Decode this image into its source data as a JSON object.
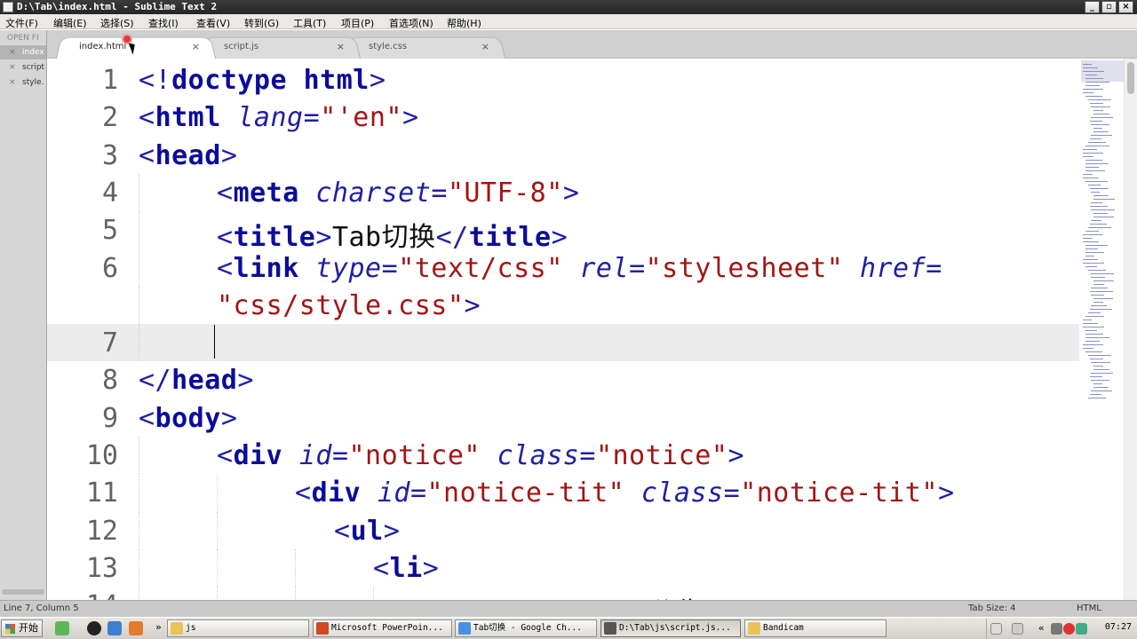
{
  "window": {
    "title": "D:\\Tab\\index.html - Sublime Text 2",
    "buttons": [
      "_",
      "▫",
      "×"
    ]
  },
  "menubar": [
    "文件(F)",
    "编辑(E)",
    "选择(S)",
    "查找(I)",
    "查看(V)",
    "转到(G)",
    "工具(T)",
    "项目(P)",
    "首选项(N)",
    "帮助(H)"
  ],
  "sidebar": {
    "header": "OPEN FI",
    "files": [
      {
        "close": "×",
        "name": "index",
        "active": true
      },
      {
        "close": "×",
        "name": "script",
        "active": false
      },
      {
        "close": "×",
        "name": "style.",
        "active": false
      }
    ]
  },
  "tabs": [
    {
      "label": "index.html",
      "close": "×",
      "active": true
    },
    {
      "label": "script.js",
      "close": "×",
      "active": false
    },
    {
      "label": "style.css",
      "close": "×",
      "active": false
    }
  ],
  "editor": {
    "current_line": 7,
    "lines": [
      {
        "num": "1",
        "indent": 0,
        "tokens": [
          [
            "br",
            "<!"
          ],
          [
            "tag",
            "doctype"
          ],
          [
            "br",
            " "
          ],
          [
            "tag",
            "html"
          ],
          [
            "br",
            ">"
          ]
        ]
      },
      {
        "num": "2",
        "indent": 0,
        "tokens": [
          [
            "br",
            "<"
          ],
          [
            "tag",
            "html"
          ],
          [
            "br",
            " "
          ],
          [
            "attr",
            "lang"
          ],
          [
            "br",
            "="
          ],
          [
            "str",
            "\"'en\""
          ],
          [
            "br",
            ">"
          ]
        ]
      },
      {
        "num": "3",
        "indent": 0,
        "tokens": [
          [
            "br",
            "<"
          ],
          [
            "tag",
            "head"
          ],
          [
            "br",
            ">"
          ]
        ]
      },
      {
        "num": "4",
        "indent": 1,
        "tokens": [
          [
            "br",
            "<"
          ],
          [
            "tag",
            "meta"
          ],
          [
            "br",
            " "
          ],
          [
            "attr",
            "charset"
          ],
          [
            "br",
            "="
          ],
          [
            "str",
            "\"UTF-8\""
          ],
          [
            "br",
            ">"
          ]
        ]
      },
      {
        "num": "5",
        "indent": 1,
        "tokens": [
          [
            "br",
            "<"
          ],
          [
            "tag",
            "title"
          ],
          [
            "br",
            ">"
          ],
          [
            "txt",
            "Tab切换"
          ],
          [
            "br",
            "</"
          ],
          [
            "tag",
            "title"
          ],
          [
            "br",
            ">"
          ]
        ]
      },
      {
        "num": "6",
        "indent": 1,
        "tokens": [
          [
            "br",
            "<"
          ],
          [
            "tag",
            "link"
          ],
          [
            "br",
            " "
          ],
          [
            "attr",
            "type"
          ],
          [
            "br",
            "="
          ],
          [
            "str",
            "\"text/css\""
          ],
          [
            "br",
            " "
          ],
          [
            "attr",
            "rel"
          ],
          [
            "br",
            "="
          ],
          [
            "str",
            "\"stylesheet\""
          ],
          [
            "br",
            " "
          ],
          [
            "attr",
            "href"
          ],
          [
            "br",
            "="
          ]
        ]
      },
      {
        "num": "",
        "indent": 1,
        "tokens": [
          [
            "str",
            "\"css/style.css\""
          ],
          [
            "br",
            ">"
          ]
        ]
      },
      {
        "num": "7",
        "indent": 1,
        "tokens": []
      },
      {
        "num": "8",
        "indent": 0,
        "tokens": [
          [
            "br",
            "</"
          ],
          [
            "tag",
            "head"
          ],
          [
            "br",
            ">"
          ]
        ]
      },
      {
        "num": "9",
        "indent": 0,
        "tokens": [
          [
            "br",
            "<"
          ],
          [
            "tag",
            "body"
          ],
          [
            "br",
            ">"
          ]
        ]
      },
      {
        "num": "10",
        "indent": 1,
        "tokens": [
          [
            "br",
            "<"
          ],
          [
            "tag",
            "div"
          ],
          [
            "br",
            " "
          ],
          [
            "attr",
            "id"
          ],
          [
            "br",
            "="
          ],
          [
            "str",
            "\"notice\""
          ],
          [
            "br",
            " "
          ],
          [
            "attr",
            "class"
          ],
          [
            "br",
            "="
          ],
          [
            "str",
            "\"notice\""
          ],
          [
            "br",
            ">"
          ]
        ]
      },
      {
        "num": "11",
        "indent": 2,
        "tokens": [
          [
            "br",
            "<"
          ],
          [
            "tag",
            "div"
          ],
          [
            "br",
            " "
          ],
          [
            "attr",
            "id"
          ],
          [
            "br",
            "="
          ],
          [
            "str",
            "\"notice-tit\""
          ],
          [
            "br",
            " "
          ],
          [
            "attr",
            "class"
          ],
          [
            "br",
            "="
          ],
          [
            "str",
            "\"notice-tit\""
          ],
          [
            "br",
            ">"
          ]
        ]
      },
      {
        "num": "12",
        "indent": 2.5,
        "tokens": [
          [
            "br",
            "<"
          ],
          [
            "tag",
            "ul"
          ],
          [
            "br",
            ">"
          ]
        ]
      },
      {
        "num": "13",
        "indent": 3,
        "tokens": [
          [
            "br",
            "<"
          ],
          [
            "tag",
            "li"
          ],
          [
            "br",
            ">"
          ]
        ]
      },
      {
        "num": "14",
        "indent": 4,
        "tokens": [
          [
            "br",
            "<"
          ],
          [
            "tag",
            "a"
          ],
          [
            "br",
            " "
          ],
          [
            "attr",
            "href"
          ],
          [
            "br",
            "="
          ],
          [
            "str",
            "\"#\""
          ],
          [
            "br",
            ">"
          ],
          [
            "txt",
            "公告"
          ],
          [
            "br",
            "</"
          ],
          [
            "tag",
            "a"
          ],
          [
            "br",
            ">"
          ]
        ]
      }
    ]
  },
  "statusbar": {
    "position": "Line 7, Column 5",
    "tab_size": "Tab Size: 4",
    "syntax": "HTML"
  },
  "taskbar": {
    "start": "开始",
    "more": "»",
    "buttons": [
      {
        "label": "js",
        "color": "#e8c35a",
        "active": false
      },
      {
        "label": "Microsoft PowerPoin...",
        "color": "#d24726",
        "active": false
      },
      {
        "label": "Tab切换 - Google Ch...",
        "color": "#4a8fe7",
        "active": false
      },
      {
        "label": "D:\\Tab\\js\\script.js...",
        "color": "#555555",
        "active": true
      },
      {
        "label": "Bandicam",
        "color": "#e8c35a",
        "active": false
      }
    ],
    "tray_more": "«",
    "clock": "07:27"
  }
}
